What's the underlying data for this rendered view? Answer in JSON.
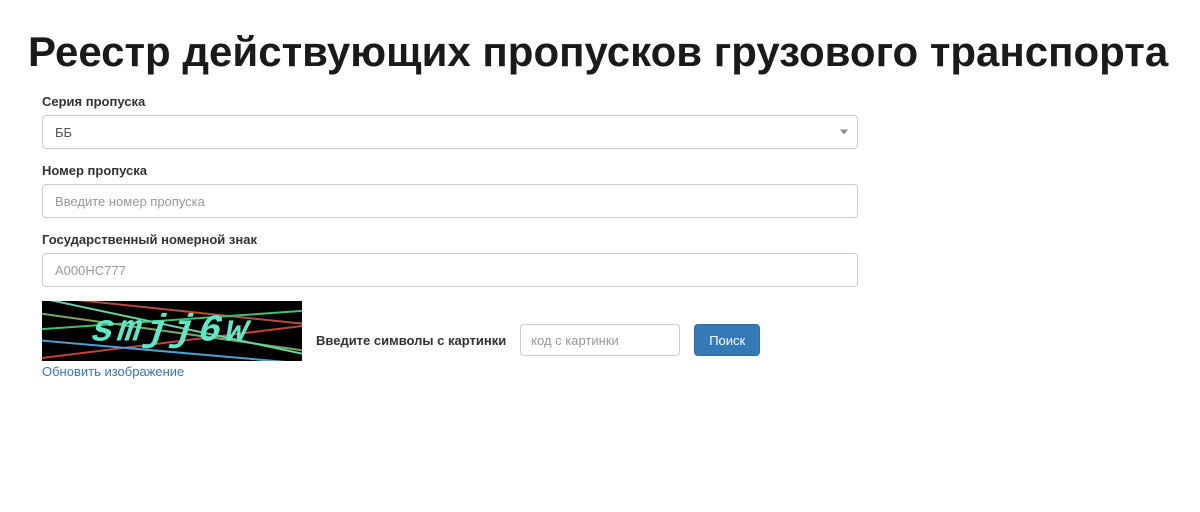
{
  "header": {
    "title": "Реестр действующих пропусков грузового транспорта"
  },
  "form": {
    "series": {
      "label": "Серия пропуска",
      "value": "ББ"
    },
    "number": {
      "label": "Номер пропуска",
      "placeholder": "Введите номер пропуска",
      "value": ""
    },
    "plate": {
      "label": "Государственный номерной знак",
      "placeholder": "А000НС777",
      "value": ""
    },
    "captcha": {
      "image_text": "smjj6w",
      "refresh_label": "Обновить изображение",
      "prompt_label": "Введите символы с картинки",
      "input_placeholder": "код с картинки",
      "input_value": "",
      "search_label": "Поиск"
    }
  }
}
